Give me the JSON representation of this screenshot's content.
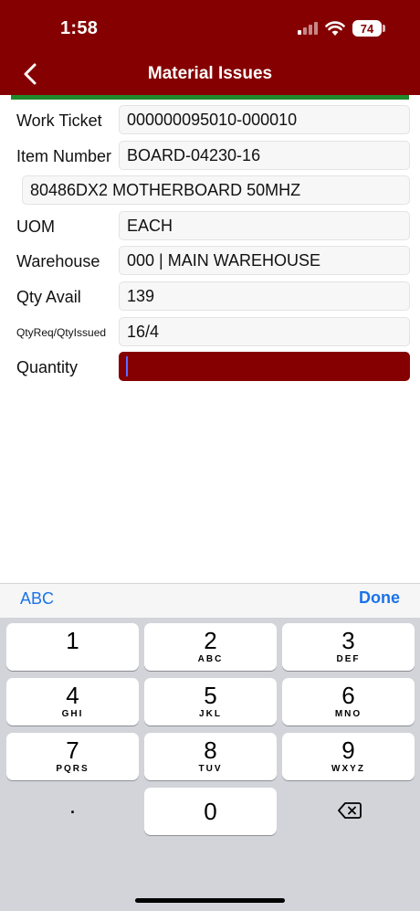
{
  "status_bar": {
    "time": "1:58",
    "battery": "74"
  },
  "header": {
    "title": "Material Issues",
    "back_icon": "chevron-left-icon"
  },
  "colors": {
    "header_bg": "#850000",
    "accent_green": "#1f8a2c",
    "link_blue": "#1a73e8"
  },
  "form": {
    "work_ticket": {
      "label": "Work Ticket",
      "value": "000000095010-000010"
    },
    "item_number": {
      "label": "Item Number",
      "value": "BOARD-04230-16"
    },
    "description": {
      "value": "80486DX2 MOTHERBOARD 50MHZ"
    },
    "uom": {
      "label": "UOM",
      "value": "EACH"
    },
    "warehouse": {
      "label": "Warehouse",
      "value": "000 | MAIN WAREHOUSE"
    },
    "qty_avail": {
      "label": "Qty Avail",
      "value": "139"
    },
    "qty_req_issued": {
      "label": "QtyReq/QtyIssued",
      "value": "16/4"
    },
    "quantity": {
      "label": "Quantity",
      "value": ""
    }
  },
  "keyboard": {
    "toolbar": {
      "abc": "ABC",
      "done": "Done"
    },
    "keys": [
      {
        "num": "1",
        "letters": ""
      },
      {
        "num": "2",
        "letters": "ABC"
      },
      {
        "num": "3",
        "letters": "DEF"
      },
      {
        "num": "4",
        "letters": "GHI"
      },
      {
        "num": "5",
        "letters": "JKL"
      },
      {
        "num": "6",
        "letters": "MNO"
      },
      {
        "num": "7",
        "letters": "PQRS"
      },
      {
        "num": "8",
        "letters": "TUV"
      },
      {
        "num": "9",
        "letters": "WXYZ"
      },
      {
        "num": "0",
        "letters": ""
      }
    ],
    "decimal": ".",
    "delete_icon": "backspace-icon"
  }
}
